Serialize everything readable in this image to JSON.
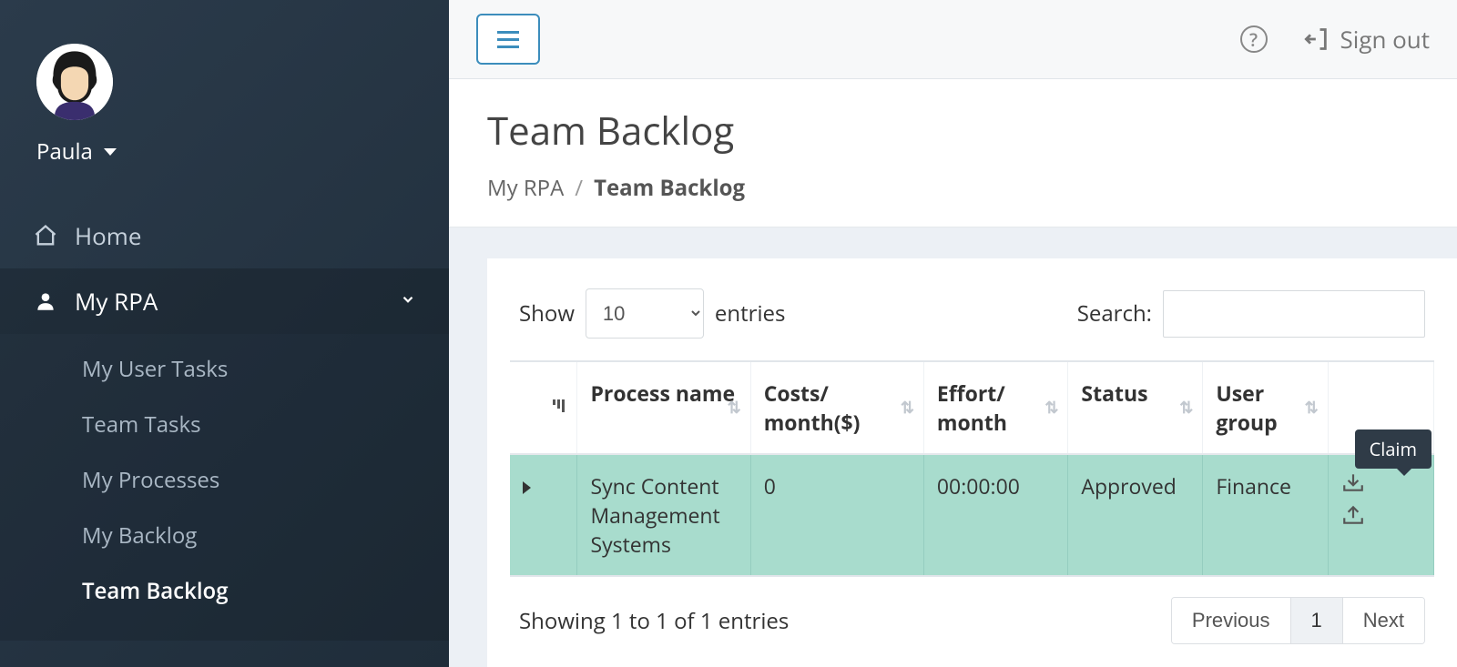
{
  "user": {
    "name": "Paula"
  },
  "sidebar": {
    "home": "Home",
    "my_rpa": "My RPA",
    "subitems": [
      {
        "label": "My User Tasks"
      },
      {
        "label": "Team Tasks"
      },
      {
        "label": "My Processes"
      },
      {
        "label": "My Backlog"
      },
      {
        "label": "Team Backlog"
      }
    ]
  },
  "topbar": {
    "signout": "Sign out"
  },
  "page": {
    "title": "Team Backlog",
    "breadcrumb_root": "My RPA",
    "breadcrumb_current": "Team Backlog"
  },
  "table": {
    "show_label_pre": "Show",
    "show_label_post": "entries",
    "show_value": "10",
    "search_label": "Search:",
    "headers": {
      "process": "Process name",
      "costs": "Costs/ month($)",
      "effort": "Effort/ month",
      "status": "Status",
      "usergroup": "User group"
    },
    "row": {
      "process": "Sync Content Management Systems",
      "costs": "0",
      "effort": "00:00:00",
      "status": "Approved",
      "usergroup": "Finance"
    },
    "tooltip": "Claim",
    "info": "Showing 1 to 1 of 1 entries",
    "pager": {
      "prev": "Previous",
      "page": "1",
      "next": "Next"
    }
  }
}
